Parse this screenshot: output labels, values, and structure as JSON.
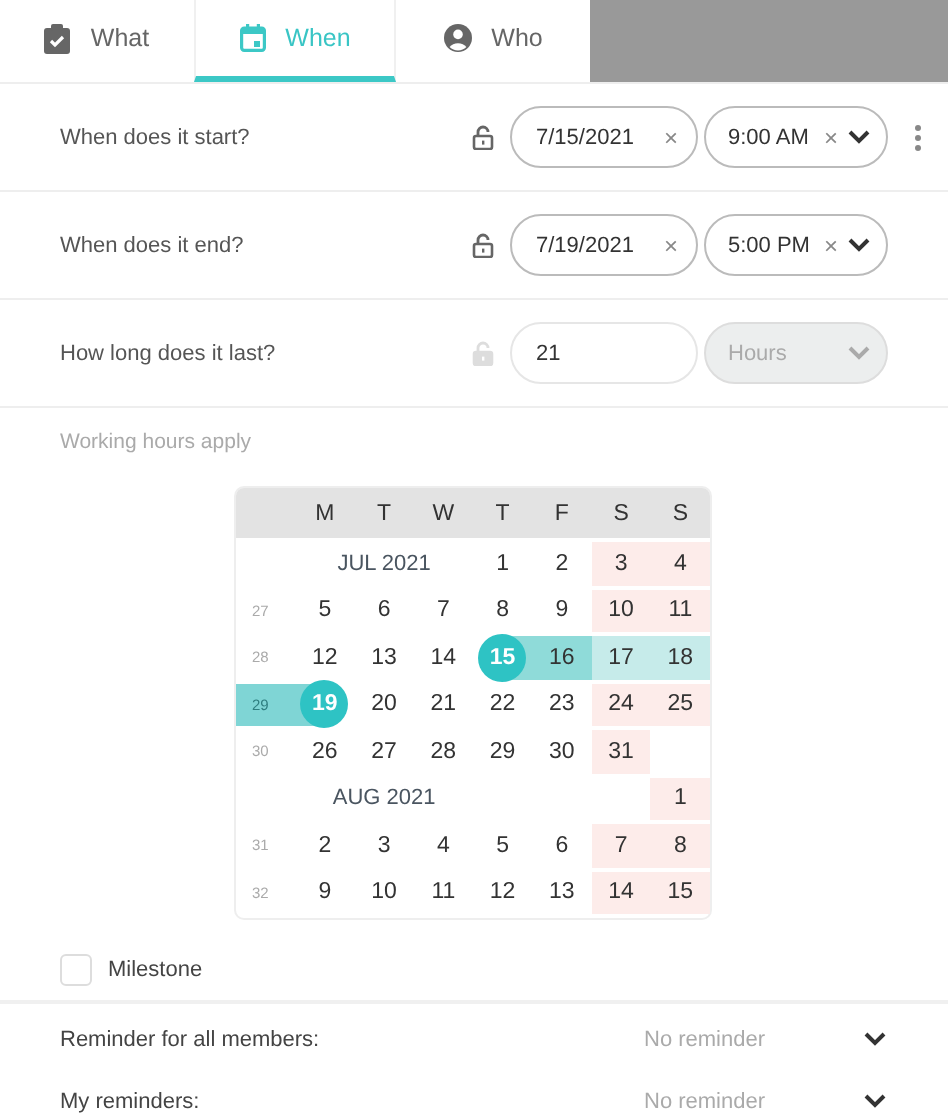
{
  "tabs": [
    {
      "label": "What",
      "selected": false
    },
    {
      "label": "When",
      "selected": true
    },
    {
      "label": "Who",
      "selected": false
    }
  ],
  "fields": [
    {
      "kind": "datetime",
      "label": "When does it start?",
      "lock_disabled": false,
      "date": "7/15/2021",
      "date_clear": "×",
      "time": "9:00 AM",
      "time_clear": "×",
      "menu": true
    },
    {
      "kind": "datetime",
      "label": "When does it end?",
      "lock_disabled": false,
      "date": "7/19/2021",
      "date_clear": "×",
      "time": "5:00 PM",
      "time_clear": "×",
      "menu": false
    },
    {
      "kind": "duration",
      "label": "How long does it last?",
      "lock_disabled": true,
      "value": "21",
      "unit": "Hours",
      "unit_disabled": true
    }
  ],
  "note": "Working hours apply",
  "calendar": {
    "weekdays": [
      "M",
      "T",
      "W",
      "T",
      "F",
      "S",
      "S"
    ],
    "rows": [
      {
        "kind": "month",
        "label": "JUL 2021",
        "days": [
          {
            "text": "1",
            "weekend": false,
            "selected": false
          },
          {
            "text": "2",
            "weekend": false,
            "selected": false
          },
          {
            "text": "3",
            "weekend": true,
            "selected": false
          },
          {
            "text": "4",
            "weekend": true,
            "selected": false
          }
        ]
      },
      {
        "kind": "week",
        "week": "27",
        "in_range": false,
        "days": [
          {
            "text": "5",
            "weekend": false,
            "selected": false
          },
          {
            "text": "6",
            "weekend": false,
            "selected": false
          },
          {
            "text": "7",
            "weekend": false,
            "selected": false
          },
          {
            "text": "8",
            "weekend": false,
            "selected": false
          },
          {
            "text": "9",
            "weekend": false,
            "selected": false
          },
          {
            "text": "10",
            "weekend": true,
            "selected": false
          },
          {
            "text": "11",
            "weekend": true,
            "selected": false
          }
        ]
      },
      {
        "kind": "week",
        "week": "28",
        "in_range": false,
        "days": [
          {
            "text": "12",
            "weekend": false,
            "selected": false
          },
          {
            "text": "13",
            "weekend": false,
            "selected": false
          },
          {
            "text": "14",
            "weekend": false,
            "selected": false
          },
          {
            "text": "15",
            "weekend": false,
            "selected": true,
            "in_range": true
          },
          {
            "text": "16",
            "weekend": false,
            "selected": false,
            "in_range": true
          },
          {
            "text": "17",
            "weekend": true,
            "selected": false,
            "in_range": true
          },
          {
            "text": "18",
            "weekend": true,
            "selected": false,
            "in_range": true
          }
        ]
      },
      {
        "kind": "week",
        "week": "29",
        "in_range": true,
        "days": [
          {
            "text": "19",
            "weekend": false,
            "selected": true,
            "in_range": true
          },
          {
            "text": "20",
            "weekend": false,
            "selected": false
          },
          {
            "text": "21",
            "weekend": false,
            "selected": false
          },
          {
            "text": "22",
            "weekend": false,
            "selected": false
          },
          {
            "text": "23",
            "weekend": false,
            "selected": false
          },
          {
            "text": "24",
            "weekend": true,
            "selected": false
          },
          {
            "text": "25",
            "weekend": true,
            "selected": false
          }
        ]
      },
      {
        "kind": "week",
        "week": "30",
        "in_range": false,
        "days": [
          {
            "text": "26",
            "weekend": false,
            "selected": false
          },
          {
            "text": "27",
            "weekend": false,
            "selected": false
          },
          {
            "text": "28",
            "weekend": false,
            "selected": false
          },
          {
            "text": "29",
            "weekend": false,
            "selected": false
          },
          {
            "text": "30",
            "weekend": false,
            "selected": false
          },
          {
            "text": "31",
            "weekend": true,
            "selected": false
          },
          {
            "kind": "empty"
          }
        ]
      },
      {
        "kind": "month",
        "label": "AUG 2021",
        "days": [
          {
            "kind": "empty"
          },
          {
            "kind": "empty"
          },
          {
            "kind": "empty"
          },
          {
            "text": "1",
            "weekend": true,
            "selected": false
          }
        ]
      },
      {
        "kind": "week",
        "week": "31",
        "in_range": false,
        "days": [
          {
            "text": "2",
            "weekend": false,
            "selected": false
          },
          {
            "text": "3",
            "weekend": false,
            "selected": false
          },
          {
            "text": "4",
            "weekend": false,
            "selected": false
          },
          {
            "text": "5",
            "weekend": false,
            "selected": false
          },
          {
            "text": "6",
            "weekend": false,
            "selected": false
          },
          {
            "text": "7",
            "weekend": true,
            "selected": false
          },
          {
            "text": "8",
            "weekend": true,
            "selected": false
          }
        ]
      },
      {
        "kind": "week",
        "week": "32",
        "in_range": false,
        "days": [
          {
            "text": "9",
            "weekend": false,
            "selected": false
          },
          {
            "text": "10",
            "weekend": false,
            "selected": false
          },
          {
            "text": "11",
            "weekend": false,
            "selected": false
          },
          {
            "text": "12",
            "weekend": false,
            "selected": false
          },
          {
            "text": "13",
            "weekend": false,
            "selected": false
          },
          {
            "text": "14",
            "weekend": true,
            "selected": false
          },
          {
            "text": "15",
            "weekend": true,
            "selected": false
          }
        ]
      }
    ]
  },
  "milestone": {
    "label": "Milestone",
    "checked": false
  },
  "reminders": [
    {
      "label": "Reminder for all members:",
      "value": "No reminder"
    },
    {
      "label": "My reminders:",
      "value": "No reminder"
    }
  ]
}
